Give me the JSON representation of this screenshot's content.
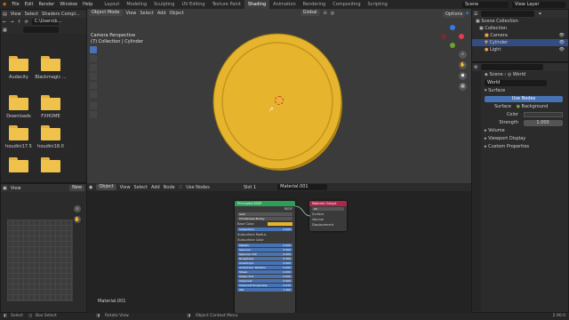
{
  "topbar": {
    "menus": [
      "File",
      "Edit",
      "Render",
      "Window",
      "Help"
    ],
    "workspaces": [
      "Layout",
      "Modeling",
      "Sculpting",
      "UV Editing",
      "Texture Paint",
      "Shading",
      "Animation",
      "Rendering",
      "Compositing",
      "Scripting"
    ],
    "active_workspace": "Shading",
    "scene": "Scene",
    "view_layer": "View Layer"
  },
  "file_browser": {
    "menu": [
      "View",
      "Select",
      "Shaders Compl..."
    ],
    "path": "C:\\Users\\b...",
    "folders": [
      "Audacity",
      "Blackmagic ...",
      "Downloads",
      "FXHOME",
      "houdini17.5",
      "houdini18.0",
      "",
      ""
    ]
  },
  "image_editor": {
    "view": "View",
    "new_label": "New"
  },
  "viewport": {
    "mode": "Object Mode",
    "menu": [
      "View",
      "Select",
      "Add",
      "Object"
    ],
    "orientation": "Global",
    "info_line1": "Camera Perspective",
    "info_line2": "(7) Collection | Cylinder",
    "options": "Options"
  },
  "node_editor": {
    "type": "Object",
    "menu": [
      "View",
      "Select",
      "Add",
      "Node"
    ],
    "use_nodes": "Use Nodes",
    "slot": "Slot 1",
    "material": "Material.001",
    "footer_material": "Material.001",
    "principled": {
      "title": "Principled BSDF",
      "output": "BSDF",
      "dist": "GGX",
      "sss": "Christensen-Burley",
      "rows": [
        {
          "label": "Base Color",
          "type": "color",
          "value": ""
        },
        {
          "label": "Subsurface",
          "type": "bar",
          "value": "0.000"
        },
        {
          "label": "Subsurface Radius",
          "type": "plain",
          "value": ""
        },
        {
          "label": "Subsurface Color",
          "type": "plain",
          "value": ""
        },
        {
          "label": "Metallic",
          "type": "bar",
          "value": "0.000"
        },
        {
          "label": "Specular",
          "type": "bar",
          "value": "0.500"
        },
        {
          "label": "Specular Tint",
          "type": "bar",
          "value": "0.000"
        },
        {
          "label": "Roughness",
          "type": "bar",
          "value": "0.500"
        },
        {
          "label": "Anisotropic",
          "type": "bar",
          "value": "0.000"
        },
        {
          "label": "Anisotropic Rotation",
          "type": "bar",
          "value": "0.000"
        },
        {
          "label": "Sheen",
          "type": "bar",
          "value": "0.000"
        },
        {
          "label": "Sheen Tint",
          "type": "bar",
          "value": "0.500"
        },
        {
          "label": "Clearcoat",
          "type": "bar",
          "value": "0.000"
        },
        {
          "label": "Clearcoat Roughness",
          "type": "bar",
          "value": "0.030"
        },
        {
          "label": "IOR",
          "type": "bar",
          "value": "1.450"
        }
      ]
    },
    "output_node": {
      "title": "Material Output",
      "target": "All",
      "sockets": [
        "Surface",
        "Volume",
        "Displacement"
      ]
    }
  },
  "outliner": {
    "root": "Scene Collection",
    "items": [
      "Collection",
      "Camera",
      "Cylinder",
      "Light"
    ],
    "selected_index": 2
  },
  "properties": {
    "scene": "Scene",
    "world": "World",
    "world_field": "World",
    "surface_section": "Surface",
    "use_nodes_btn": "Use Nodes",
    "surface_label": "Surface",
    "surface_value": "Background",
    "color_label": "Color",
    "strength_label": "Strength",
    "strength_value": "1.000",
    "sections": [
      "Volume",
      "Viewport Display",
      "Custom Properties"
    ]
  },
  "statusbar": {
    "left1": "Select",
    "left2": "Box Select",
    "mid": "Rotate View",
    "right1": "Object Context Menu",
    "version": "2.90.0"
  },
  "colors": {
    "accent": "#4772b3",
    "material_yellow": "#e6b52d",
    "folder_yellow": "#f0c24b",
    "output_node_header": "#a8294a",
    "principled_header": "#2e9e57"
  }
}
